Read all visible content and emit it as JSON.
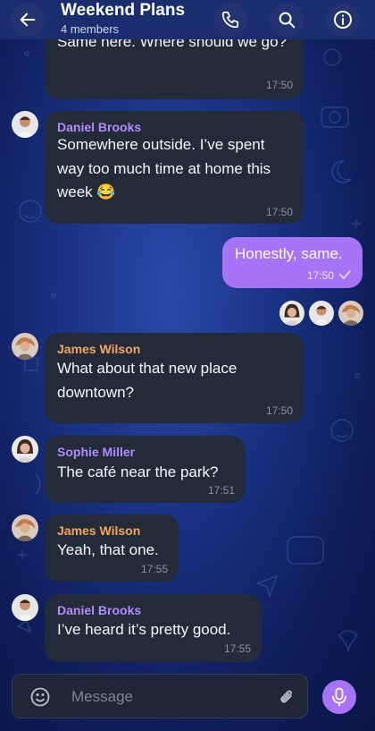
{
  "header": {
    "title": "Weekend Plans",
    "subtitle": "4 members"
  },
  "colors": {
    "header_bg": "#1a2d6e",
    "bubble_bg": "#232a38",
    "own_bubble_bg": "#a874f7",
    "name_purple": "#b28cff",
    "name_orange": "#f5a65b"
  },
  "messages": [
    {
      "sender": "",
      "text": "Same here. Where should we go?",
      "time": "17:50"
    },
    {
      "sender": "Daniel Brooks",
      "text": "Somewhere outside. I’ve spent way too much time at home this week 😂",
      "time": "17:50"
    },
    {
      "sender": "",
      "text": "Honestly, same.",
      "time": "17:50",
      "own": true,
      "status": "sent-check"
    },
    {
      "sender": "James Wilson",
      "text": "What about that new place downtown?",
      "time": "17:50"
    },
    {
      "sender": "Sophie Miller",
      "text": "The café near the park?",
      "time": "17:51"
    },
    {
      "sender": "James Wilson",
      "text": "Yeah, that one.",
      "time": "17:55"
    },
    {
      "sender": "Daniel Brooks",
      "text": "I’ve heard it’s pretty good.",
      "time": "17:55"
    }
  ],
  "read_receipts": [
    "sophie-avatar",
    "daniel-avatar",
    "james-avatar"
  ],
  "composer": {
    "placeholder": "Message"
  },
  "icons": {
    "back": "arrow-left-icon",
    "call": "phone-icon",
    "search": "search-icon",
    "info": "info-icon",
    "emoji": "smiley-icon",
    "attach": "paperclip-icon",
    "mic": "microphone-icon"
  }
}
